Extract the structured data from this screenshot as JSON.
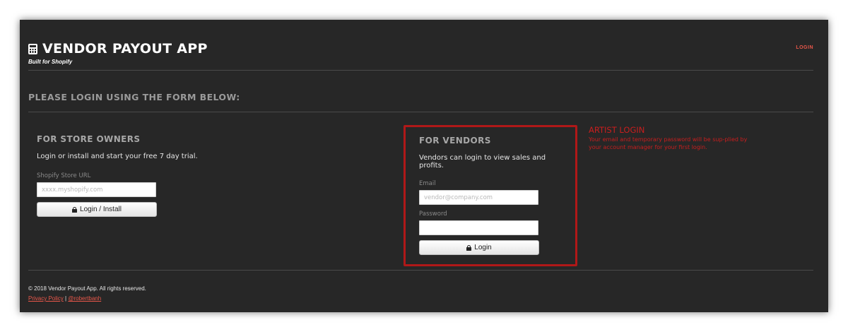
{
  "header": {
    "title": "VENDOR PAYOUT APP",
    "tagline": "Built for Shopify",
    "icon": "calculator-icon",
    "nav_login": "LOGIN"
  },
  "prompt": "PLEASE LOGIN USING THE FORM BELOW:",
  "owners": {
    "title": "FOR STORE OWNERS",
    "description": "Login or install and start your free 7 day trial.",
    "store_url_label": "Shopify Store URL",
    "store_url_placeholder": "xxxx.myshopify.com",
    "store_url_value": "",
    "button_label": "Login / Install",
    "button_icon": "lock-icon"
  },
  "vendors": {
    "title": "FOR VENDORS",
    "description": "Vendors can login to view sales and profits.",
    "email_label": "Email",
    "email_placeholder": "vendor@company.com",
    "email_value": "",
    "password_label": "Password",
    "password_value": "",
    "button_label": "Login",
    "button_icon": "lock-icon",
    "highlight_color": "#b01818"
  },
  "artist": {
    "title": "ARTIST LOGIN",
    "text": "Your email and temporary password will be sup-plied by your account manager for your first login.",
    "color": "#c81e1e"
  },
  "footer": {
    "copyright": "© 2018 Vendor Payout App. All rights reserved.",
    "privacy_link": "Privacy Policy",
    "separator": "|",
    "author_link": "@robertbanh"
  },
  "colors": {
    "background": "#272727",
    "accent": "#e8574a"
  }
}
